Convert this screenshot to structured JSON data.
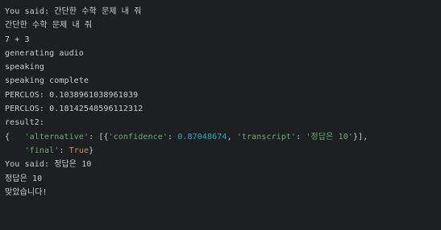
{
  "terminal": {
    "lines": [
      "You said: 간단한 수학 문제 내 줘",
      "간단한 수학 문제 내 줘",
      "7 + 3",
      "generating audio",
      "speaking",
      "speaking complete",
      "PERCLOS: 0.1038961038961039",
      "PERCLOS: 0.18142548596112312",
      "result2:",
      "You said: 정답은 10",
      "정답은 10",
      "맞았습니다!"
    ],
    "result": {
      "open_brace": "{",
      "key_alternative": "'alternative'",
      "colon1": ": [{",
      "key_confidence": "'confidence'",
      "colon2": ": ",
      "confidence_value": "0.87048674",
      "comma1": ", ",
      "key_transcript": "'transcript'",
      "colon3": ": ",
      "transcript_value": "'정답은 10'",
      "close1": "}],",
      "key_final": "'final'",
      "colon4": ": ",
      "final_value": "True",
      "close2": "}"
    }
  },
  "colors": {
    "background": "#1e1f22",
    "text": "#c9ccd1",
    "string": "#6aab73",
    "number": "#2aacb8",
    "keyword": "#cf8e6d"
  }
}
